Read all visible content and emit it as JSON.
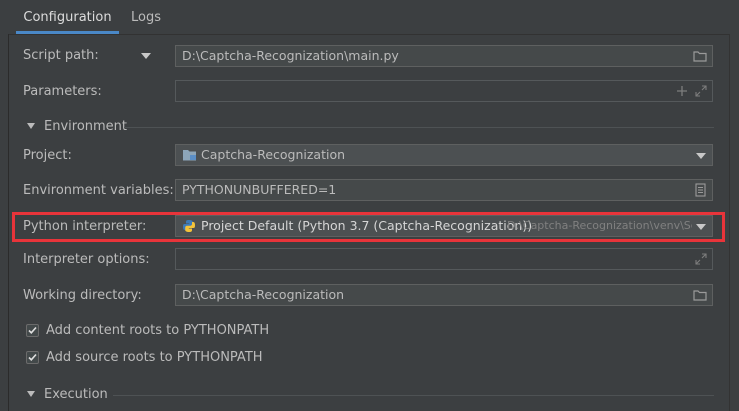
{
  "tabs": [
    {
      "label": "Configuration",
      "active": true
    },
    {
      "label": "Logs",
      "active": false
    }
  ],
  "script_path": {
    "label": "Script path:",
    "value": "D:\\Captcha-Recognization\\main.py",
    "icon": "folder-icon"
  },
  "parameters": {
    "label": "Parameters:",
    "value": "",
    "icons": [
      "plus-icon",
      "expand-icon"
    ]
  },
  "environment": {
    "header": "Environment"
  },
  "project": {
    "label": "Project:",
    "value": "Captcha-Recognization",
    "icon": "project-folder-icon"
  },
  "env_vars": {
    "label": "Environment variables:",
    "value": "PYTHONUNBUFFERED=1",
    "icon": "document-icon"
  },
  "interpreter": {
    "label": "Python interpreter:",
    "value": "Project Default (Python 3.7 (Captcha-Recognization))",
    "path": "D:\\Captcha-Recognization\\venv\\Sc",
    "icon": "python-icon"
  },
  "interpreter_options": {
    "label": "Interpreter options:",
    "value": "",
    "icon": "expand-icon"
  },
  "working_dir": {
    "label": "Working directory:",
    "value": "D:\\Captcha-Recognization",
    "icon": "folder-icon"
  },
  "checkboxes": [
    {
      "label": "Add content roots to PYTHONPATH",
      "checked": true
    },
    {
      "label": "Add source roots to PYTHONPATH",
      "checked": true
    }
  ],
  "execution": {
    "header": "Execution"
  },
  "colors": {
    "background": "#3c3f41",
    "accent": "#4a88c7",
    "highlight": "#e8343a"
  }
}
